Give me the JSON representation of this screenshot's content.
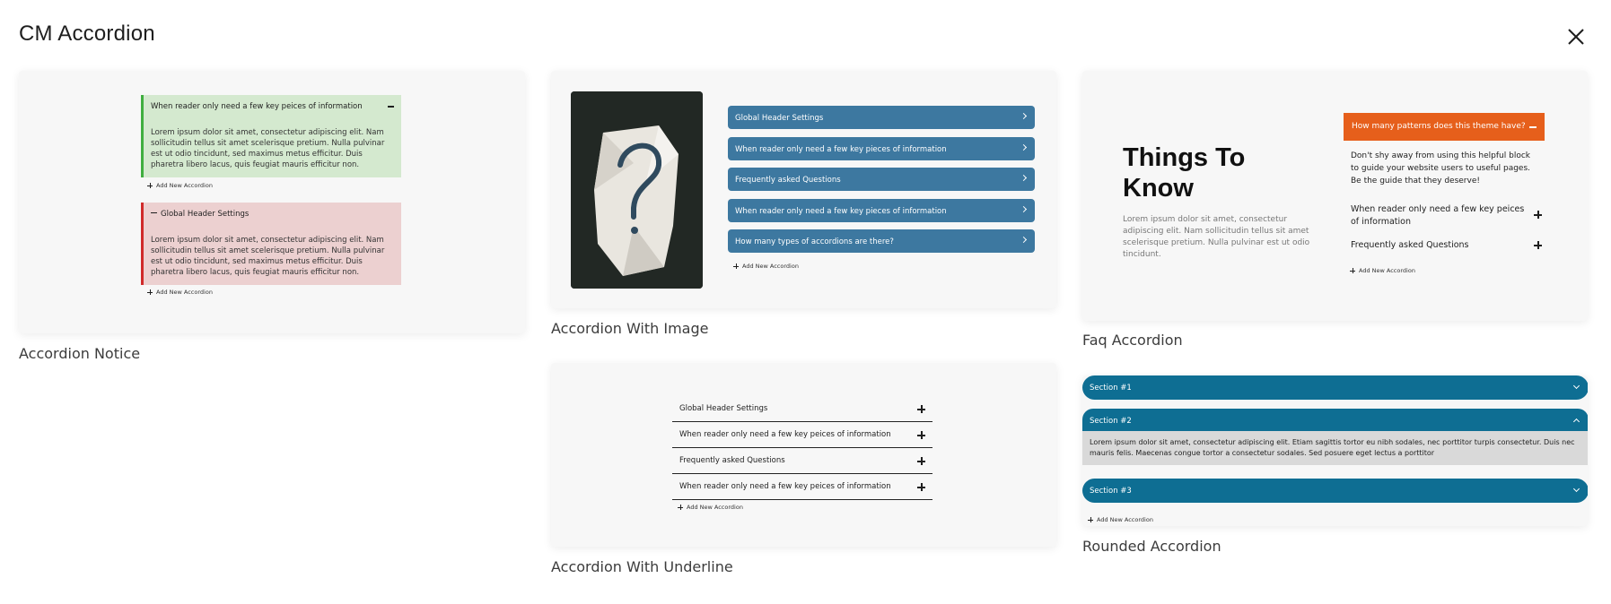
{
  "modal": {
    "title": "CM Accordion",
    "close_icon": "close-icon"
  },
  "patterns": {
    "notice": {
      "caption": "Accordion Notice",
      "green_heading": "When reader only need a few key peices of information",
      "green_body": "Lorem ipsum dolor sit amet, consectetur adipiscing elit. Nam sollicitudin tellus sit amet scelerisque pretium. Nulla pulvinar est ut odio tincidunt, sed maximus metus efficitur. Duis pharetra libero lacus, quis feugiat mauris efficitur non.",
      "red_heading": "Global Header Settings",
      "red_body": "Lorem ipsum dolor sit amet, consectetur adipiscing elit. Nam sollicitudin tellus sit amet scelerisque pretium. Nulla pulvinar est ut odio tincidunt, sed maximus metus efficitur. Duis pharetra libero lacus, quis feugiat mauris efficitur non.",
      "add_new": "Add New Accordion",
      "green_border": "#3fae3f",
      "red_border": "#d02a2a"
    },
    "image": {
      "caption": "Accordion With Image",
      "items": [
        "Global Header Settings",
        "When reader only need a few key pieces of information",
        "Frequently asked Questions",
        "When reader only need a few key pieces of information",
        "How many types of accordions are there?"
      ],
      "add_new": "Add New Accordion",
      "item_color": "#3d78a0"
    },
    "faq": {
      "caption": "Faq Accordion",
      "title": "Things To Know",
      "text": "Lorem ipsum dolor sit amet, consectetur adipiscing elit. Nam sollicitudin tellus sit amet scelerisque pretium. Nulla pulvinar est ut odio tincidunt.",
      "active_question": "How many patterns does this theme have?",
      "active_answer": "Don't shy away from using this helpful block to guide your website users to useful pages. Be the guide that they deserve!",
      "question_2": "When reader only need a few key peices of information",
      "question_3": "Frequently asked Questions",
      "add_new": "Add New Accordion",
      "accent": "#e65f1b"
    },
    "underline": {
      "caption": "Accordion With Underline",
      "items": [
        "Global Header Settings",
        "When reader only need a few key peices of information",
        "Frequently asked Questions",
        "When reader only need a few key peices of information"
      ],
      "add_new": "Add New Accordion"
    },
    "rounded": {
      "caption": "Rounded Accordion",
      "section_1": "Section #1",
      "section_2": "Section #2",
      "section_3": "Section #3",
      "body": "Lorem ipsum dolor sit amet, consectetur adipiscing elit. Etiam sagittis tortor eu nibh sodales, nec porttitor turpis consectetur. Duis nec mauris felis. Maecenas congue tortor a consectetur sodales. Sed posuere eget lectus a porttitor",
      "add_new": "Add New Accordion",
      "pill_color": "#0e6e93"
    }
  }
}
